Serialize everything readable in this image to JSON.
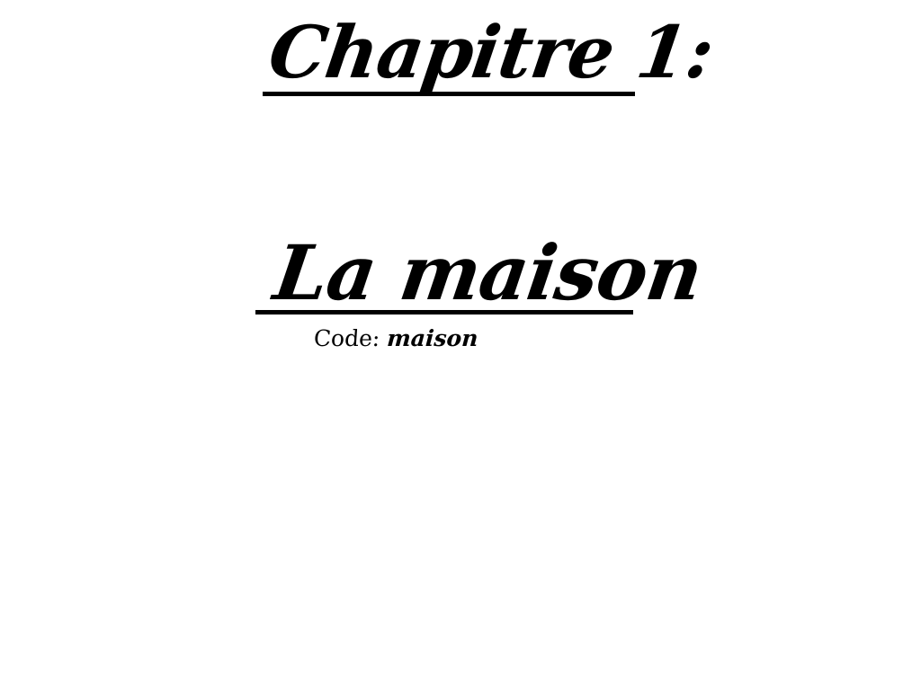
{
  "document": {
    "chapter_title": "Chapitre 1:",
    "section_title": "La maison",
    "code": {
      "label": "Code:",
      "value": "maison"
    }
  },
  "colors": {
    "background": "#ffffff",
    "text": "#000000"
  }
}
